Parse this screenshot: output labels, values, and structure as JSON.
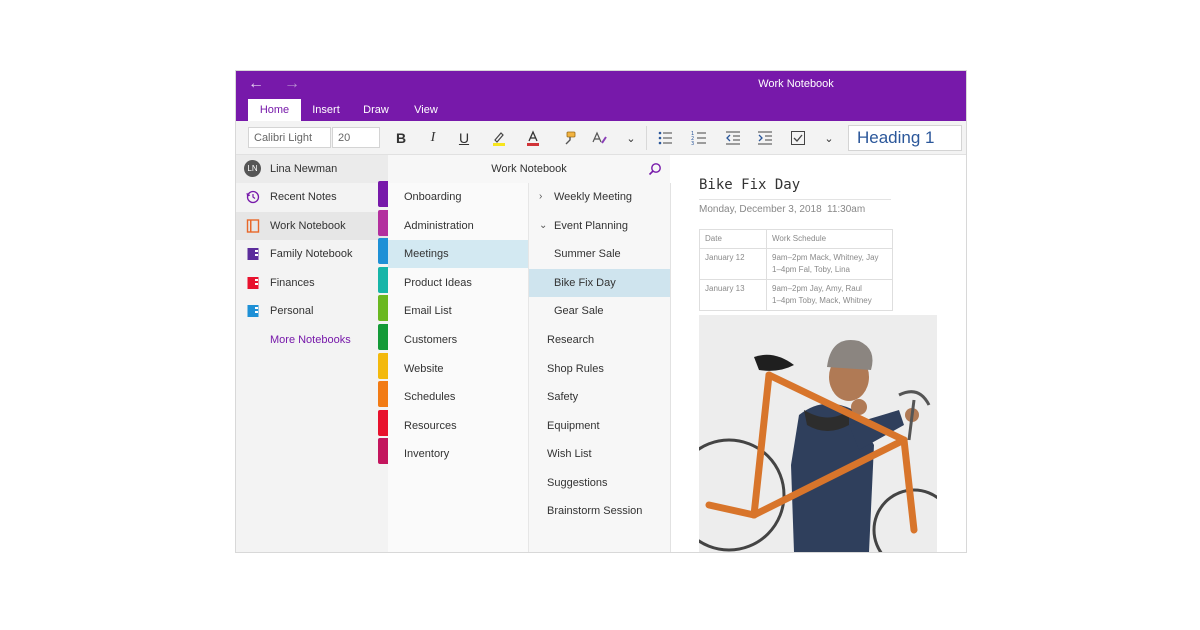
{
  "window": {
    "title": "Work Notebook"
  },
  "tabs": [
    {
      "label": "Home"
    },
    {
      "label": "Insert"
    },
    {
      "label": "Draw"
    },
    {
      "label": "View"
    }
  ],
  "ribbon": {
    "font_name": "Calibri Light",
    "font_size": "20",
    "bold": "B",
    "italic": "I",
    "underline": "U",
    "heading_style": "Heading 1"
  },
  "user": {
    "initials": "LN",
    "name": "Lina Newman"
  },
  "notebooks": [
    {
      "label": "Recent Notes",
      "icon": "clock-icon",
      "color": "#7719aa"
    },
    {
      "label": "Work Notebook",
      "icon": "notebook-icon",
      "color": "#e8682a"
    },
    {
      "label": "Family Notebook",
      "icon": "notebook-icon",
      "color": "#5b2c9b"
    },
    {
      "label": "Finances",
      "icon": "notebook-icon",
      "color": "#e8112d"
    },
    {
      "label": "Personal",
      "icon": "notebook-icon",
      "color": "#1e90d6"
    }
  ],
  "more_notebooks": "More Notebooks",
  "notebook_header": "Work Notebook",
  "sections": [
    {
      "label": "Onboarding",
      "color": "#7719aa"
    },
    {
      "label": "Administration",
      "color": "#b32f9e"
    },
    {
      "label": "Meetings",
      "color": "#1e90d6"
    },
    {
      "label": "Product Ideas",
      "color": "#16b5a8"
    },
    {
      "label": "Email List",
      "color": "#6ab820"
    },
    {
      "label": "Customers",
      "color": "#139a37"
    },
    {
      "label": "Website",
      "color": "#f3b90d"
    },
    {
      "label": "Schedules",
      "color": "#f27b14"
    },
    {
      "label": "Resources",
      "color": "#e8112d"
    },
    {
      "label": "Inventory",
      "color": "#c3155d"
    }
  ],
  "pages": [
    {
      "label": "Weekly Meeting",
      "chevron": ">"
    },
    {
      "label": "Event Planning",
      "chevron": "v"
    },
    {
      "label": "Summer Sale"
    },
    {
      "label": "Bike Fix Day"
    },
    {
      "label": "Gear Sale"
    },
    {
      "label": "Research"
    },
    {
      "label": "Shop Rules"
    },
    {
      "label": "Safety"
    },
    {
      "label": "Equipment"
    },
    {
      "label": "Wish List"
    },
    {
      "label": "Suggestions"
    },
    {
      "label": "Brainstorm Session"
    }
  ],
  "page": {
    "title": "Bike Fix Day",
    "date": "Monday, December 3, 2018",
    "time": "11:30am",
    "table": {
      "headers": [
        "Date",
        "Work Schedule"
      ],
      "rows": [
        {
          "date": "January 12",
          "line1": "9am–2pm Mack, Whitney, Jay",
          "line2": "1–4pm Fal, Toby, Lina"
        },
        {
          "date": "January 13",
          "line1": "9am–2pm Jay, Amy, Raul",
          "line2": "1–4pm Toby, Mack, Whitney"
        }
      ]
    }
  },
  "colors": {
    "brand": "#7719aa",
    "selection": "#d3e9f2"
  }
}
